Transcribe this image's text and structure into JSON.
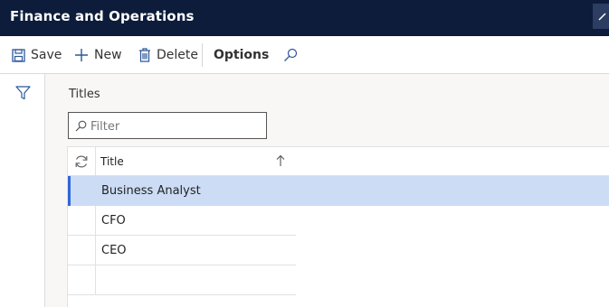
{
  "app": {
    "title": "Finance and Operations"
  },
  "toolbar": {
    "save_label": "Save",
    "new_label": "New",
    "delete_label": "Delete",
    "options_label": "Options"
  },
  "main": {
    "section_label": "Titles",
    "filter": {
      "placeholder": "Filter",
      "value": ""
    },
    "grid": {
      "columns": [
        "Title"
      ],
      "sort": "ascending",
      "rows": [
        "Business Analyst",
        "CFO",
        "CEO",
        ""
      ],
      "selected_row": 0
    }
  },
  "colors": {
    "header_bg": "#0c1c3a",
    "selected_row_bg": "#ccdcf5",
    "selection_marker": "#2f67d8",
    "accent": "#2b579a"
  },
  "icons": [
    "save-icon",
    "plus-icon",
    "trash-icon",
    "search-icon",
    "filter-funnel-icon",
    "refresh-icon",
    "sort-ascending-icon"
  ]
}
